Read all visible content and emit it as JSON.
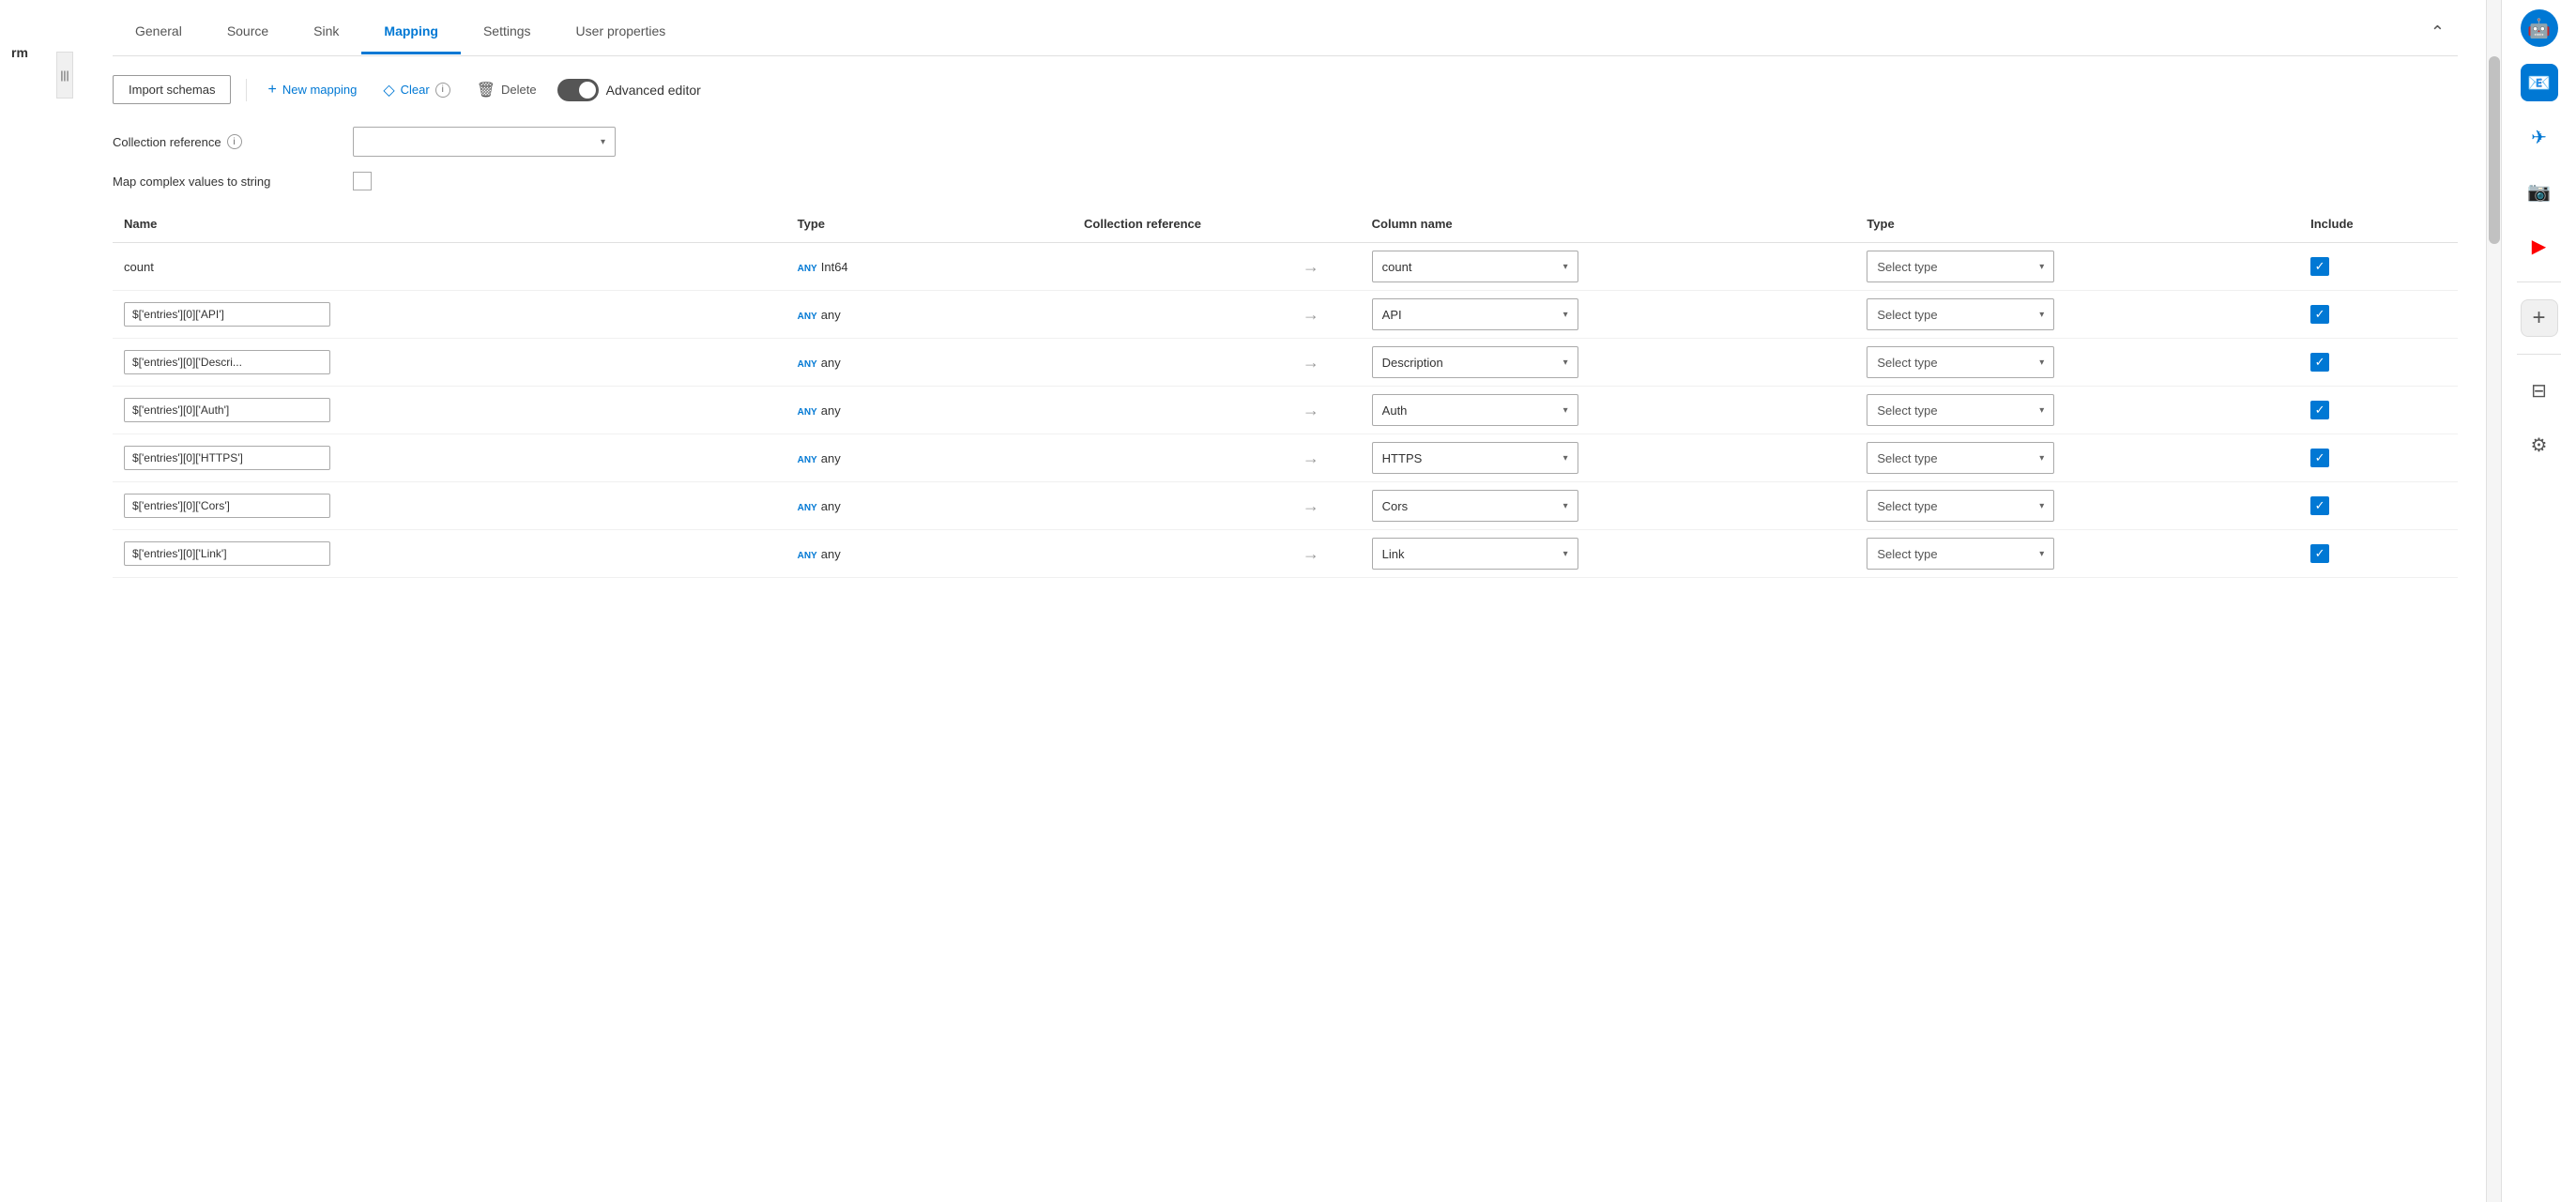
{
  "leftLabel": "rm",
  "tabs": [
    {
      "id": "general",
      "label": "General",
      "active": false
    },
    {
      "id": "source",
      "label": "Source",
      "active": false
    },
    {
      "id": "sink",
      "label": "Sink",
      "active": false
    },
    {
      "id": "mapping",
      "label": "Mapping",
      "active": true
    },
    {
      "id": "settings",
      "label": "Settings",
      "active": false
    },
    {
      "id": "userproperties",
      "label": "User properties",
      "active": false
    }
  ],
  "toolbar": {
    "importLabel": "Import schemas",
    "newMappingLabel": "New mapping",
    "clearLabel": "Clear",
    "deleteLabel": "Delete",
    "advancedEditorLabel": "Advanced editor"
  },
  "form": {
    "collectionReferenceLabel": "Collection reference",
    "mapComplexLabel": "Map complex values to string"
  },
  "tableHeaders": {
    "name": "Name",
    "type": "Type",
    "collectionRef": "Collection reference",
    "columnName": "Column name",
    "type2": "Type",
    "include": "Include"
  },
  "rows": [
    {
      "nameIsText": true,
      "nameText": "count",
      "typeBadge": "ANY",
      "typeValue": "Int64",
      "columnName": "count",
      "typeSelect": "Select type",
      "include": true
    },
    {
      "nameIsText": false,
      "nameInput": "$['entries'][0]['API']",
      "typeBadge": "ANY",
      "typeValue": "any",
      "columnName": "API",
      "typeSelect": "Select type",
      "include": true
    },
    {
      "nameIsText": false,
      "nameInput": "$['entries'][0]['Descri...",
      "typeBadge": "ANY",
      "typeValue": "any",
      "columnName": "Description",
      "typeSelect": "Select type",
      "include": true
    },
    {
      "nameIsText": false,
      "nameInput": "$['entries'][0]['Auth']",
      "typeBadge": "ANY",
      "typeValue": "any",
      "columnName": "Auth",
      "typeSelect": "Select type",
      "include": true
    },
    {
      "nameIsText": false,
      "nameInput": "$['entries'][0]['HTTPS']",
      "typeBadge": "ANY",
      "typeValue": "any",
      "columnName": "HTTPS",
      "typeSelect": "Select type",
      "include": true
    },
    {
      "nameIsText": false,
      "nameInput": "$['entries'][0]['Cors']",
      "typeBadge": "ANY",
      "typeValue": "any",
      "columnName": "Cors",
      "typeSelect": "Select type",
      "include": true
    },
    {
      "nameIsText": false,
      "nameInput": "$['entries'][0]['Link']",
      "typeBadge": "ANY",
      "typeValue": "any",
      "columnName": "Link",
      "typeSelect": "Select type",
      "include": true
    }
  ],
  "icons": {
    "plus": "+",
    "clear": "◇",
    "trash": "🗑",
    "chevronDown": "▾",
    "arrow": "→",
    "check": "✓",
    "info": "i",
    "collapse": "⌃",
    "settings": "⚙",
    "window": "⊟"
  },
  "sidebarIcons": [
    {
      "name": "copilot",
      "symbol": "🤖",
      "colorClass": "blue"
    },
    {
      "name": "outlook",
      "symbol": "📧",
      "colorClass": "outlook"
    },
    {
      "name": "paper-plane",
      "symbol": "✉",
      "colorClass": "paper"
    },
    {
      "name": "instagram",
      "symbol": "📷",
      "colorClass": "instagram"
    },
    {
      "name": "youtube",
      "symbol": "▶",
      "colorClass": "youtube"
    }
  ]
}
